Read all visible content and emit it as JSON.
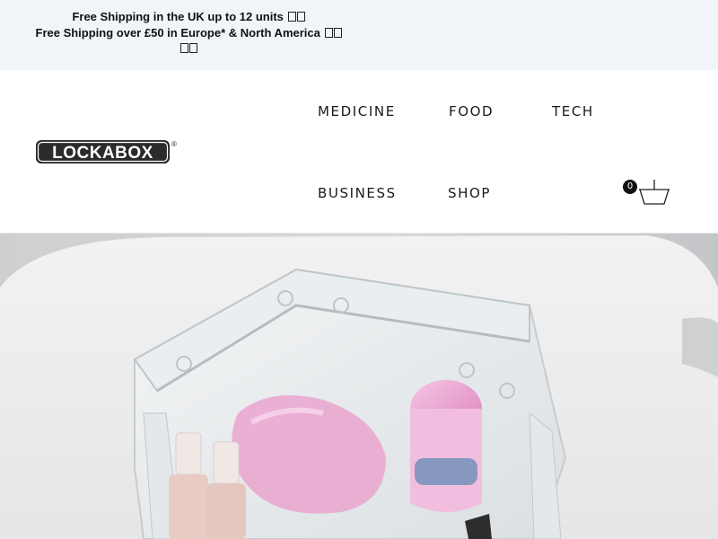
{
  "announcement": {
    "line1": "Free Shipping in the UK up to 12 units",
    "line2": "Free Shipping over £50 in Europe* & North America"
  },
  "header": {
    "logo_text": "LOCKABOX",
    "logo_mark": "®",
    "nav": {
      "medicine": "MEDICINE",
      "food": "FOOD",
      "tech": "TECH",
      "business": "BUSINESS",
      "shop": "SHOP"
    },
    "cart": {
      "count": "0",
      "icon": "basket-icon"
    }
  },
  "hero": {
    "image": "clear-lockable-box-with-toiletries",
    "colors": {
      "box": "#e7ecee",
      "table": "#eeeeee",
      "pink": "#e7a6cf"
    }
  }
}
